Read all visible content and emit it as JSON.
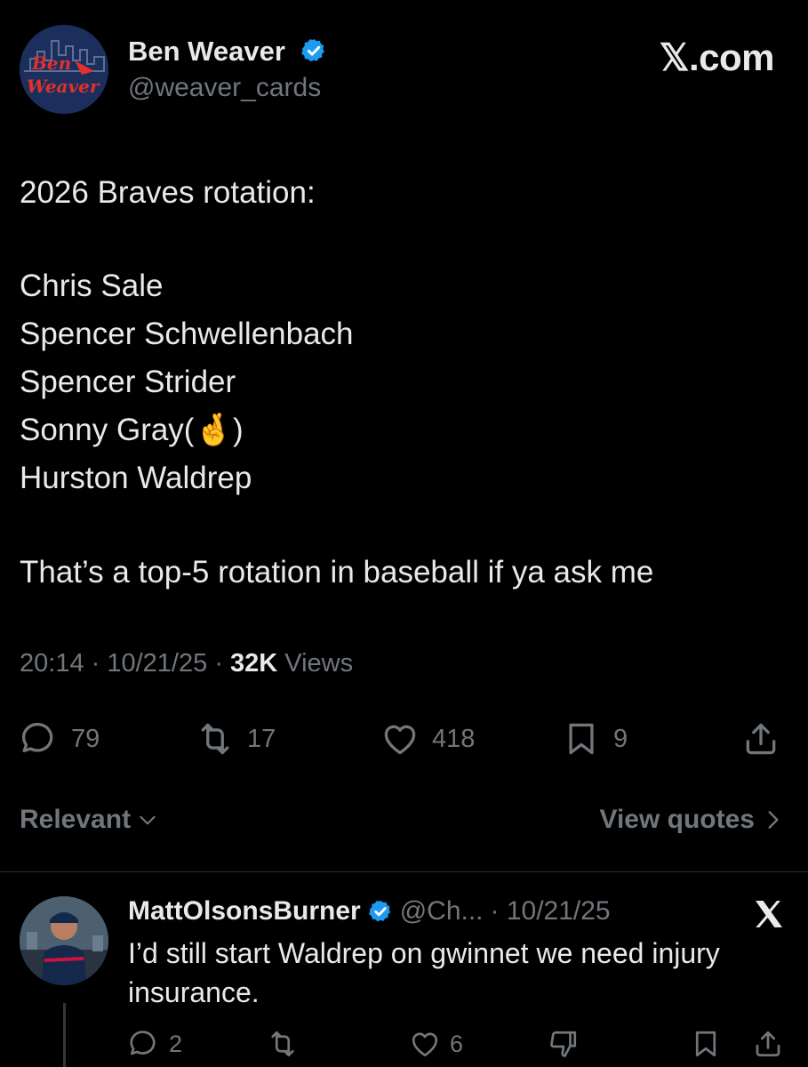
{
  "post": {
    "author_name": "Ben Weaver",
    "author_handle": "@weaver_cards",
    "avatar_text_top": "Ben",
    "avatar_text_bottom": "Weaver",
    "brand": "𝕏.com",
    "lines": [
      "2026 Braves rotation:",
      "Chris Sale",
      "Spencer Schwellenbach",
      "Spencer Strider",
      "Sonny Gray(🤞)",
      "Hurston Waldrep",
      "That’s a top-5 rotation in baseball if ya ask me"
    ],
    "time": "20:14",
    "date": "10/21/25",
    "views_count": "32K",
    "views_label": "Views",
    "replies": "79",
    "reposts": "17",
    "likes": "418",
    "bookmarks": "9"
  },
  "sort": {
    "label": "Relevant",
    "view_quotes": "View quotes"
  },
  "reply": {
    "name": "MattOlsonsBurner",
    "handle": "@Ch...",
    "date": "· 10/21/25",
    "text": "I’d still start Waldrep on gwinnet we need injury insurance.",
    "replies": "2",
    "likes": "6"
  },
  "colors": {
    "background": "#000000",
    "text": "#e7e9ea",
    "muted": "#71767b",
    "verified": "#1d9bf0",
    "avatar_red": "#e0322b"
  }
}
